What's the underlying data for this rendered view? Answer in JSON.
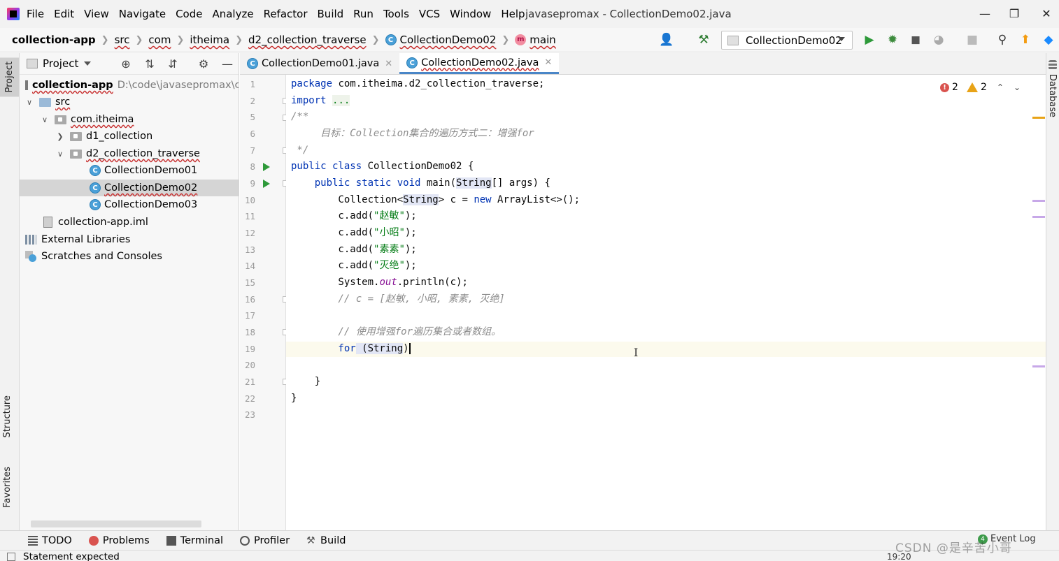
{
  "menubar": {
    "items": [
      "File",
      "Edit",
      "View",
      "Navigate",
      "Code",
      "Analyze",
      "Refactor",
      "Build",
      "Run",
      "Tools",
      "VCS",
      "Window",
      "Help"
    ],
    "window_title": "javasepromax - CollectionDemo02.java"
  },
  "navbar": {
    "crumbs": [
      "collection-app",
      "src",
      "com",
      "itheima",
      "d2_collection_traverse",
      "CollectionDemo02",
      "main"
    ],
    "run_config": "CollectionDemo02"
  },
  "left_stripe": {
    "project": "Project",
    "structure": "Structure",
    "favorites": "Favorites"
  },
  "project_panel": {
    "title": "Project",
    "tree": [
      {
        "label": "collection-app",
        "extra": "D:\\code\\javasepromax\\colle"
      },
      {
        "label": "src"
      },
      {
        "label": "com.itheima"
      },
      {
        "label": "d1_collection"
      },
      {
        "label": "d2_collection_traverse"
      },
      {
        "label": "CollectionDemo01"
      },
      {
        "label": "CollectionDemo02"
      },
      {
        "label": "CollectionDemo03"
      },
      {
        "label": "collection-app.iml"
      },
      {
        "label": "External Libraries"
      },
      {
        "label": "Scratches and Consoles"
      }
    ]
  },
  "editor": {
    "tabs": [
      {
        "label": "CollectionDemo01.java"
      },
      {
        "label": "CollectionDemo02.java"
      }
    ],
    "inspections": {
      "errors": "2",
      "warnings": "2"
    },
    "line_numbers": [
      "1",
      "2",
      "5",
      "6",
      "7",
      "8",
      "9",
      "10",
      "11",
      "12",
      "13",
      "14",
      "15",
      "16",
      "17",
      "18",
      "19",
      "20",
      "21",
      "22",
      "23"
    ],
    "code": {
      "l1_kw": "package",
      "l1_rest": " com.itheima.d2_collection_traverse;",
      "l2_kw": "import",
      "l2_dots": "...",
      "l5": "/**",
      "l6": "     目标：Collection集合的遍历方式二：增强for",
      "l7": " */",
      "l8_kw": "public class",
      "l8_rest": " CollectionDemo02 {",
      "l9_kw": "    public static void",
      "l9_name": " main(",
      "l9_type": "String",
      "l9_rest": "[] args) {",
      "l10_a": "        Collection<",
      "l10_type": "String",
      "l10_b": "> c = ",
      "l10_kw": "new",
      "l10_c": " ArrayList<>();",
      "l11_a": "        c.add(",
      "l11_s": "\"赵敏\"",
      "l11_b": ");",
      "l12_a": "        c.add(",
      "l12_s": "\"小昭\"",
      "l12_b": ");",
      "l13_a": "        c.add(",
      "l13_s": "\"素素\"",
      "l13_b": ");",
      "l14_a": "        c.add(",
      "l14_s": "\"灭绝\"",
      "l14_b": ");",
      "l15_a": "        System.",
      "l15_f": "out",
      "l15_b": ".println(c);",
      "l16": "        // c = [赵敏, 小昭, 素素, 灭绝]",
      "l18": "        // 使用增强for遍历集合或者数组。",
      "l19_kw": "        for",
      "l19_a": " (String",
      "l19_b": ")",
      "l21": "    }",
      "l22": "}"
    }
  },
  "right_stripe": {
    "database": "Database"
  },
  "bottom_tools": [
    "TODO",
    "Problems",
    "Terminal",
    "Profiler",
    "Build"
  ],
  "status": {
    "message": "Statement expected",
    "position": "19:20",
    "event_log": "Event Log",
    "event_count": "4"
  },
  "watermark": "CSDN @是辛苦小哥",
  "colors": {
    "accent": "#4a86c7",
    "run_green": "#2e9a3a",
    "error": "#d9534f",
    "warning": "#e8a317"
  }
}
